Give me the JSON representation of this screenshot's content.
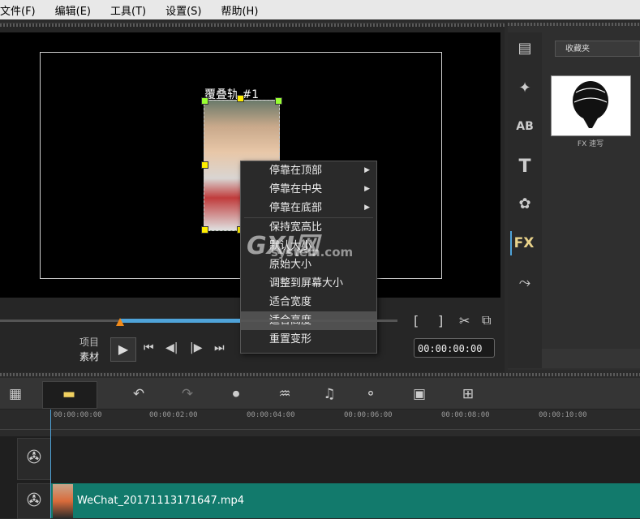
{
  "menubar": {
    "items": [
      "文件(F)",
      "编辑(E)",
      "工具(T)",
      "设置(S)",
      "帮助(H)"
    ]
  },
  "preview": {
    "overlay_label": "覆叠轨  #1",
    "context_menu": {
      "items": [
        {
          "label": "停靠在顶部",
          "submenu": true
        },
        {
          "label": "停靠在中央",
          "submenu": true
        },
        {
          "label": "停靠在底部",
          "submenu": true
        },
        {
          "label": "保持宽高比",
          "submenu": false
        },
        {
          "label": "默认大小",
          "submenu": false
        },
        {
          "label": "原始大小",
          "submenu": false
        },
        {
          "label": "调整到屏幕大小",
          "submenu": false
        },
        {
          "label": "适合宽度",
          "submenu": false
        },
        {
          "label": "适合高度",
          "submenu": false,
          "highlighted": true
        },
        {
          "label": "重置变形",
          "submenu": false
        }
      ]
    },
    "watermark": "GXI网",
    "watermark_sub": "system.com"
  },
  "player": {
    "mode_project": "项目",
    "mode_clip": "素材",
    "timecode": "00:00:00:00"
  },
  "library": {
    "favorites_label": "收藏夹",
    "thumbnail_label": "FX 速写",
    "icons": [
      "media-icon",
      "transition-icon",
      "title-ab-icon",
      "text-t-icon",
      "graphic-icon",
      "fx-icon",
      "path-icon"
    ],
    "fx_label": "FX"
  },
  "timeline": {
    "ruler_ticks": [
      "00:00:00:00",
      "00:00:02:00",
      "00:00:04:00",
      "00:00:06:00",
      "00:00:08:00",
      "00:00:10:00"
    ],
    "clip_name": "WeChat_20171113171647.mp4",
    "accent": "#4fa3d9",
    "clip_color": "#127a6c"
  }
}
